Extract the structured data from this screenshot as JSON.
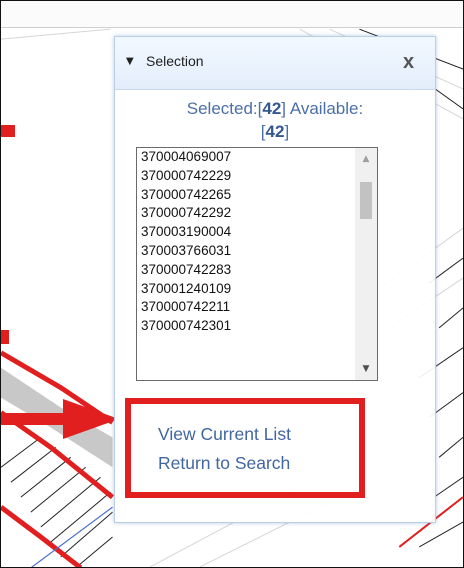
{
  "panel": {
    "title": "Selection",
    "caret_icon": "▼",
    "close_icon": "x",
    "selected_label": "Selected:[",
    "selected_count": "42",
    "selected_suffix": "]",
    "available_label": " Available:",
    "available_open": "[",
    "available_count": "42",
    "available_close": "]"
  },
  "list": {
    "items": [
      "370004069007",
      "370000742229",
      "370000742265",
      "370000742292",
      "370003190004",
      "370003766031",
      "370000742283",
      "370001240109",
      "370000742211",
      "370000742301"
    ],
    "scroll_up_icon": "▲",
    "scroll_down_icon": "▼"
  },
  "links": {
    "view_current_list": "View Current List",
    "return_to_search": "Return to Search"
  },
  "colors": {
    "highlight_red": "#e11f1f",
    "link_blue": "#4266a0",
    "panel_border": "#b8cfe6"
  }
}
